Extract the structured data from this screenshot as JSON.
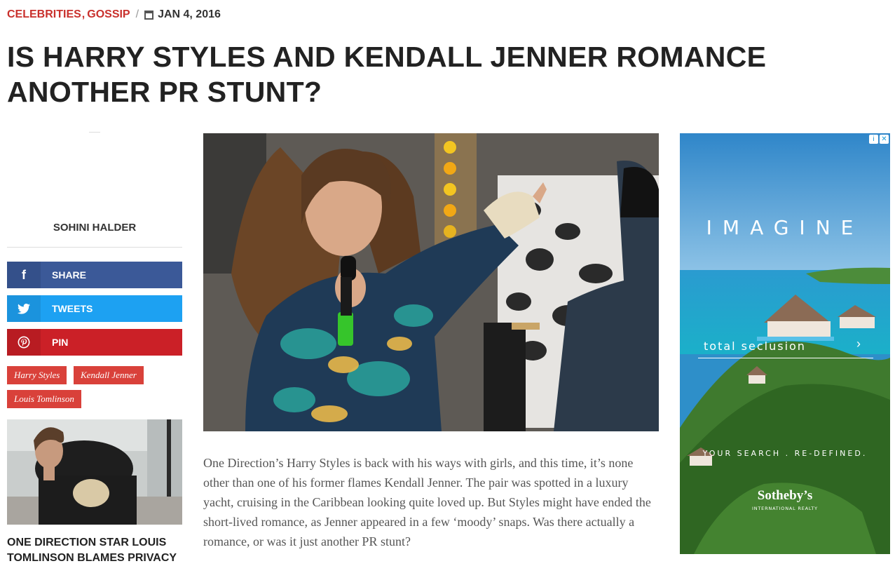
{
  "meta": {
    "categories": [
      "CELEBRITIES",
      "GOSSIP"
    ],
    "separator": "/",
    "date": "JAN 4, 2016"
  },
  "headline": "IS HARRY STYLES AND KENDALL JENNER ROMANCE ANOTHER PR STUNT?",
  "author": "SOHINI HALDER",
  "share": {
    "facebook_icon": "f",
    "facebook_label": "SHARE",
    "twitter_label": "TWEETS",
    "pinterest_label": "PIN"
  },
  "tags": [
    "Harry Styles",
    "Kendall Jenner",
    "Louis Tomlinson"
  ],
  "related": {
    "title": "ONE DIRECTION STAR LOUIS TOMLINSON BLAMES PRIVACY"
  },
  "article": {
    "body": "One Direction’s Harry Styles is back with his ways with girls, and this time, it’s none other than one of his former flames Kendall Jenner. The pair was spotted in a luxury yacht, cruising in the Caribbean looking quite loved up. But Styles might have ended the short-lived romance, as Jenner appeared in a few ‘moody’ snaps. Was there actually a romance, or was it just another PR stunt?"
  },
  "ad": {
    "headline": "IMAGINE",
    "tagline": "total seclusion",
    "arrow": "›",
    "subline": "YOUR SEARCH . RE-DEFINED.",
    "brand": "Sotheby’s",
    "brand_sub": "INTERNATIONAL REALTY",
    "info_icon": "i",
    "close_icon": "✕"
  },
  "colors": {
    "accent": "#c9302c",
    "facebook": "#3b5998",
    "twitter": "#1da1f2",
    "pinterest": "#cb2027",
    "tag": "#d9413a"
  },
  "icons": [
    "calendar-icon",
    "facebook-icon",
    "twitter-icon",
    "pinterest-icon",
    "ad-info-icon",
    "ad-close-icon"
  ]
}
